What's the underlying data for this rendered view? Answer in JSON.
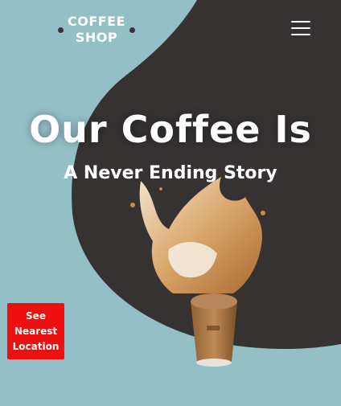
{
  "header": {
    "logo_text": "COFFEE\nSHOP",
    "menu_icon": "hamburger-menu-icon"
  },
  "hero": {
    "headline": "Our Coffee Is",
    "subheadline": "A Never Ending Story",
    "image_icon": "coffee-splash-cup-image"
  },
  "cta": {
    "label": "See\nNearest\nLocation"
  },
  "colors": {
    "background": "#94bfc6",
    "blob": "#363232",
    "cta": "#ee1010",
    "text": "#ffffff"
  }
}
